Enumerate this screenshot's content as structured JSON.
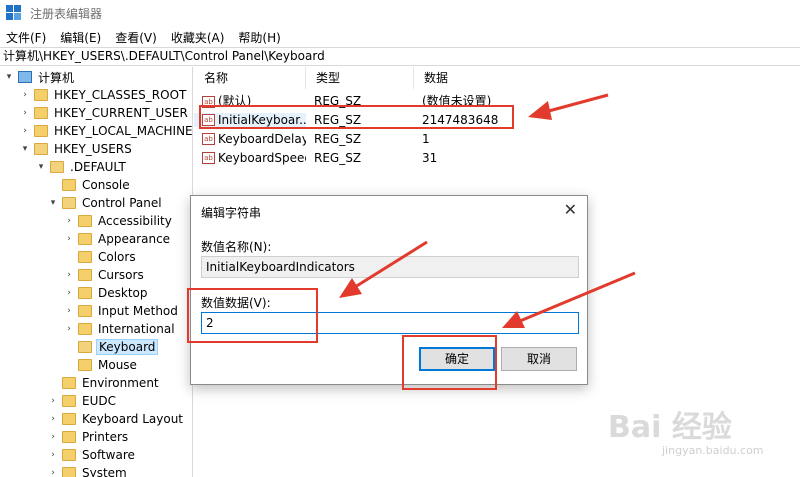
{
  "window": {
    "title": "注册表编辑器"
  },
  "menu": [
    "文件(F)",
    "编辑(E)",
    "查看(V)",
    "收藏夹(A)",
    "帮助(H)"
  ],
  "address": "计算机\\HKEY_USERS\\.DEFAULT\\Control Panel\\Keyboard",
  "tree": {
    "items": [
      {
        "label": "计算机"
      },
      {
        "label": "HKEY_CLASSES_ROOT"
      },
      {
        "label": "HKEY_CURRENT_USER"
      },
      {
        "label": "HKEY_LOCAL_MACHINE"
      },
      {
        "label": "HKEY_USERS"
      },
      {
        "label": ".DEFAULT"
      },
      {
        "label": "Console"
      },
      {
        "label": "Control Panel"
      },
      {
        "label": "Accessibility"
      },
      {
        "label": "Appearance"
      },
      {
        "label": "Colors"
      },
      {
        "label": "Cursors"
      },
      {
        "label": "Desktop"
      },
      {
        "label": "Input Method"
      },
      {
        "label": "International"
      },
      {
        "label": "Keyboard"
      },
      {
        "label": "Mouse"
      },
      {
        "label": "Environment"
      },
      {
        "label": "EUDC"
      },
      {
        "label": "Keyboard Layout"
      },
      {
        "label": "Printers"
      },
      {
        "label": "Software"
      },
      {
        "label": "System"
      }
    ]
  },
  "list": {
    "headers": [
      "名称",
      "类型",
      "数据"
    ],
    "rows": [
      {
        "name": "(默认)",
        "type": "REG_SZ",
        "data": "(数值未设置)"
      },
      {
        "name": "InitialKeyboar...",
        "type": "REG_SZ",
        "data": "2147483648"
      },
      {
        "name": "KeyboardDelay",
        "type": "REG_SZ",
        "data": "1"
      },
      {
        "name": "KeyboardSpeed",
        "type": "REG_SZ",
        "data": "31"
      }
    ]
  },
  "dialog": {
    "title": "编辑字符串",
    "name_label": "数值名称(N):",
    "name_value": "InitialKeyboardIndicators",
    "data_label": "数值数据(V):",
    "data_value": "2",
    "ok": "确定",
    "cancel": "取消"
  },
  "icons": {
    "registry": "registry-icon",
    "folder": "folder-icon",
    "computer": "computer-icon",
    "string_value": "string-value-icon",
    "close": "close-icon"
  },
  "colors": {
    "annotation": "#e23b2d",
    "accent": "#0078d7",
    "selection": "#cce8ff"
  },
  "watermark": {
    "brand": "Bai 经验",
    "url": "jingyan.baidu.com"
  }
}
